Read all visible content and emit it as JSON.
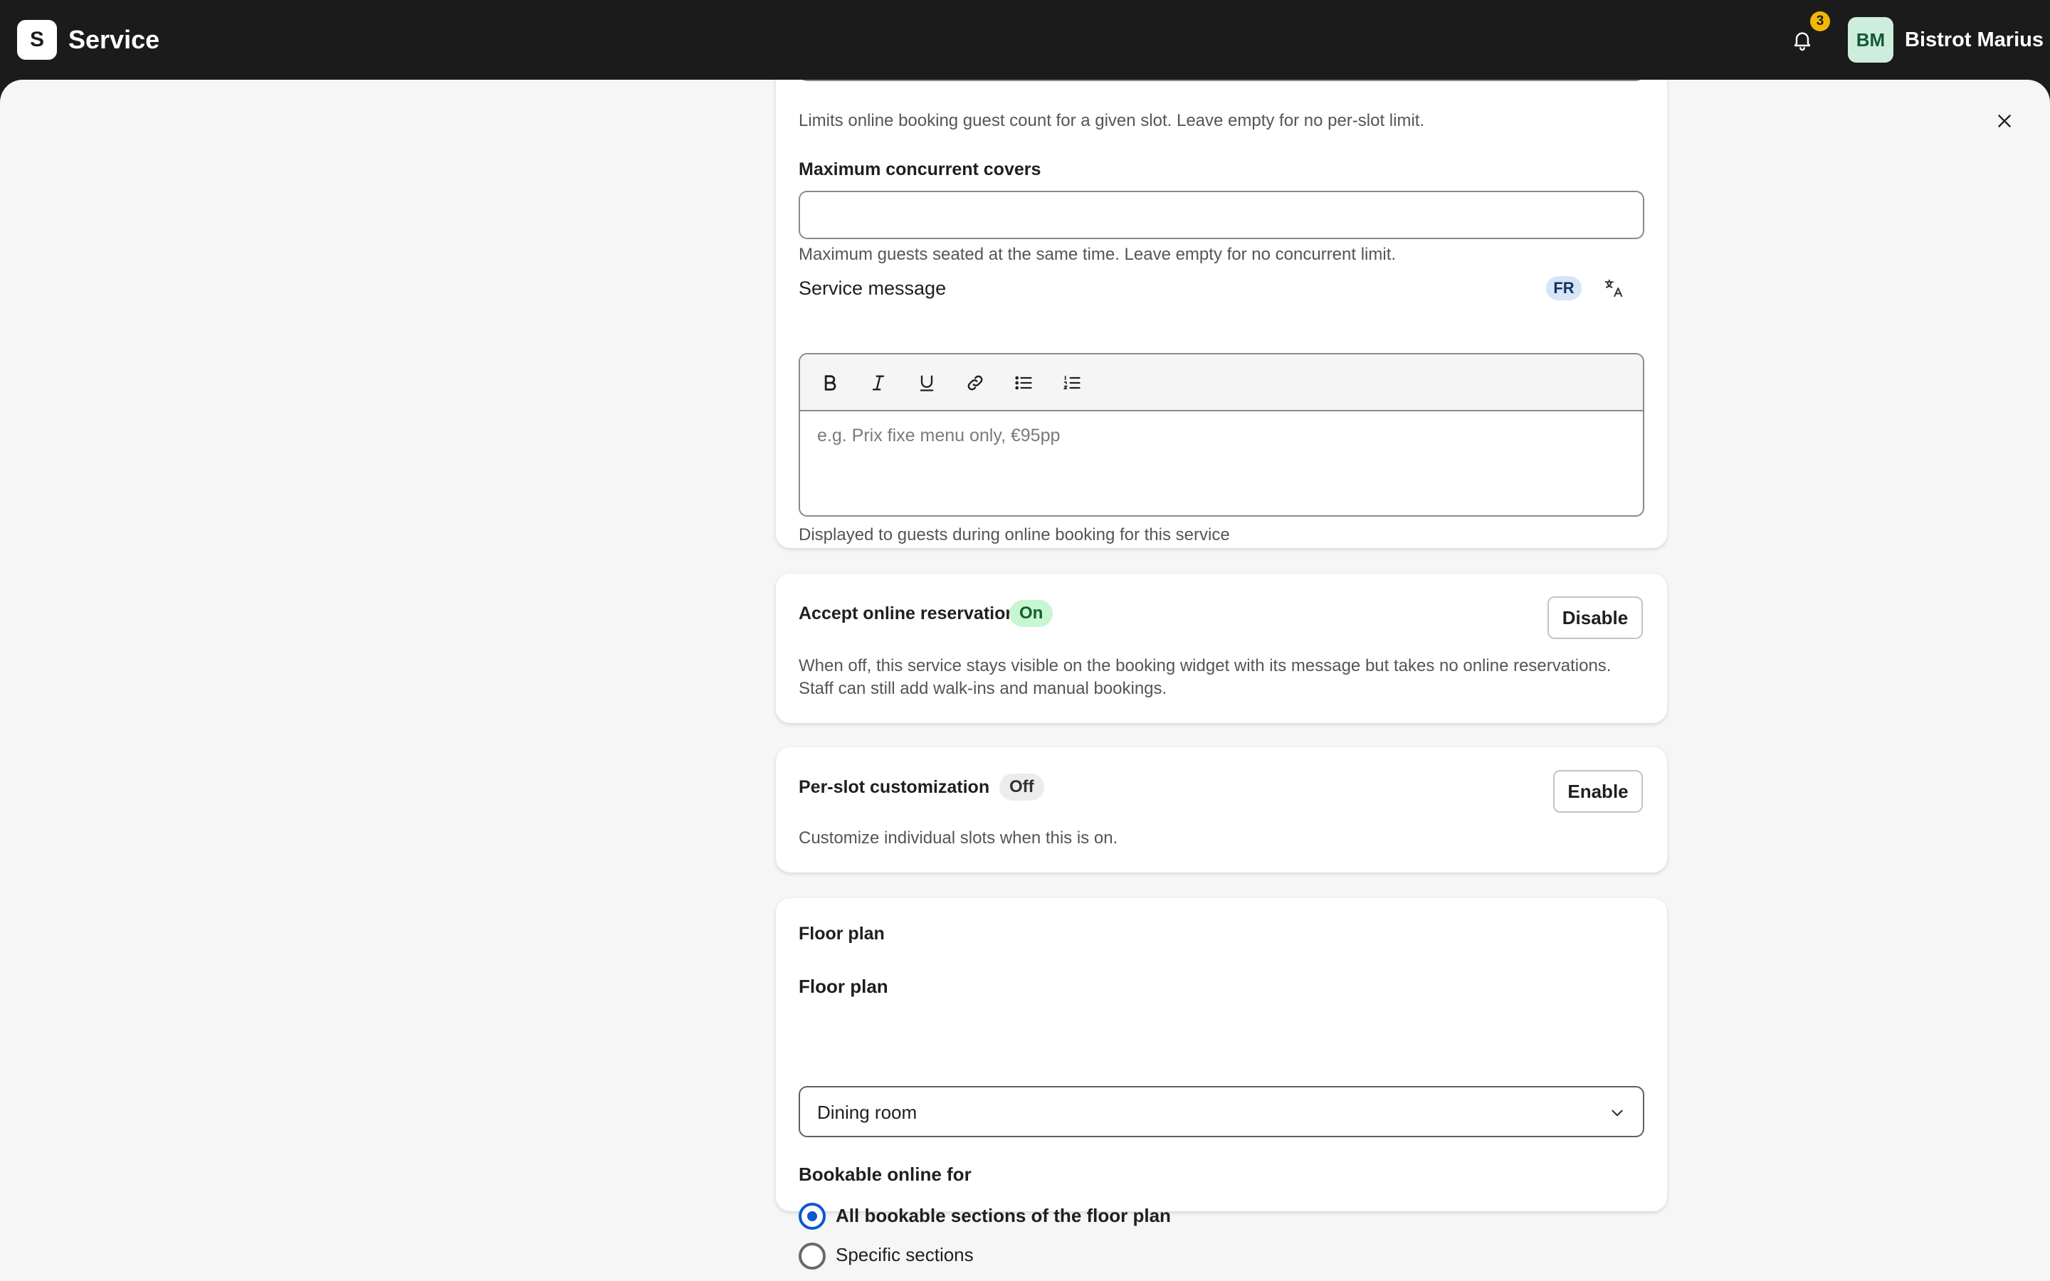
{
  "app": {
    "logo_letter": "S",
    "title": "Service"
  },
  "notifications": {
    "count": "3"
  },
  "user": {
    "initials": "BM",
    "name": "Bistrot Marius"
  },
  "form": {
    "slot_limit_help": "Limits online booking guest count for a given slot. Leave empty for no per-slot limit.",
    "max_concurrent": {
      "label": "Maximum concurrent covers",
      "value": "",
      "help": "Maximum guests seated at the same time. Leave empty for no concurrent limit."
    },
    "service_message": {
      "label": "Service message",
      "language_badge": "FR",
      "placeholder": "e.g. Prix fixe menu only, €95pp",
      "help": "Displayed to guests during online booking for this service",
      "toolbar": [
        "bold-icon",
        "italic-icon",
        "underline-icon",
        "link-icon",
        "bulleted-list-icon",
        "numbered-list-icon"
      ]
    }
  },
  "online_reservations": {
    "title": "Accept online reservations",
    "status": "On",
    "button_label": "Disable",
    "description_line1": "When off, this service stays visible on the booking widget with its message but takes no online reservations.",
    "description_line2": "Staff can still add walk-ins and manual bookings."
  },
  "per_slot": {
    "title": "Per-slot customization",
    "status": "Off",
    "button_label": "Enable",
    "description": "Customize individual slots when this is on."
  },
  "floor_plan": {
    "section_title": "Floor plan",
    "field_label": "Floor plan",
    "selected": "Dining room",
    "bookable_label": "Bookable online for",
    "options": [
      {
        "label": "All bookable sections of the floor plan",
        "checked": true
      },
      {
        "label": "Specific sections",
        "checked": false
      }
    ]
  },
  "colors": {
    "topbar": "#1b1b1b",
    "accent": "#0b57d0",
    "badge": "#f2b705",
    "on_pill": "#c8f5d2"
  }
}
